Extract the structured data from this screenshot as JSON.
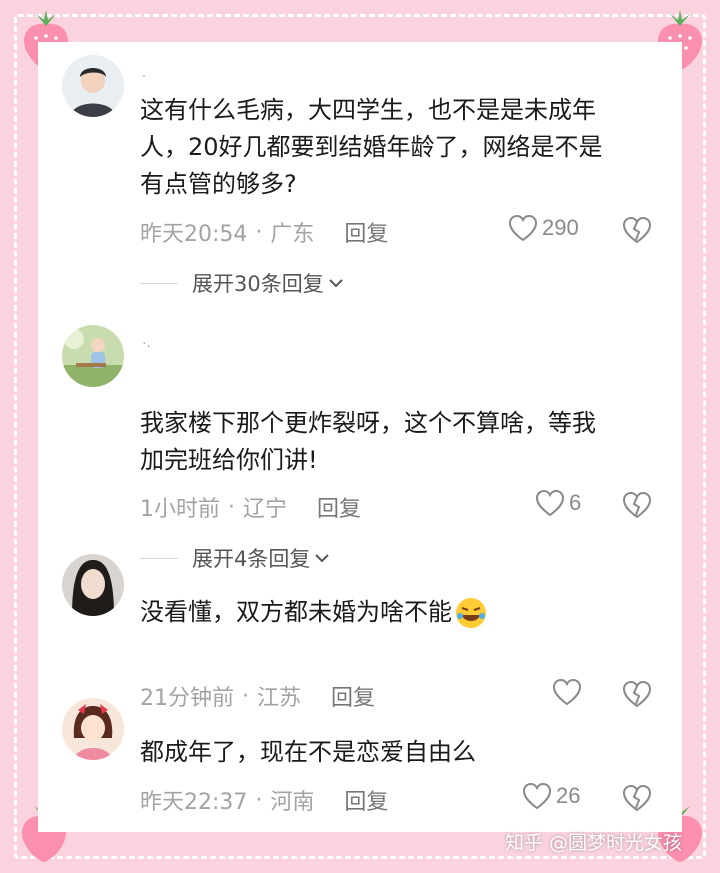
{
  "colors": {
    "frame_pink": "#fbd3df",
    "strawberry": "#fb8fae",
    "leaf": "#5cae5a",
    "text_primary": "#1a1a1a",
    "text_secondary": "#a3a3a3"
  },
  "comments": [
    {
      "username": ".",
      "avatar_icon": "avatar-young-man",
      "text_lines": [
        "这有什么毛病，大四学生，也不是是未成年",
        "人，20好几都要到结婚年龄了，网络是不是",
        "有点管的够多?"
      ],
      "time": "昨天20:54",
      "separator": "·",
      "location": "广东",
      "reply_label": "回复",
      "likes": "290",
      "expand_label": "展开30条回复"
    },
    {
      "username": "·.",
      "avatar_icon": "avatar-child-outdoor",
      "text_lines": [
        "我家楼下那个更炸裂呀，这个不算啥，等我",
        "加完班给你们讲!"
      ],
      "time": "1小时前",
      "separator": "·",
      "location": "辽宁",
      "reply_label": "回复",
      "likes": "6",
      "expand_label": "展开4条回复"
    },
    {
      "username": "",
      "avatar_icon": "avatar-woman",
      "text_lines": [
        "没看懂，双方都未婚为啥不能"
      ],
      "emoji": "rolling-laughing-emoji",
      "time": "21分钟前",
      "separator": "·",
      "location": "江苏",
      "reply_label": "回复",
      "likes": ""
    },
    {
      "username": "",
      "avatar_icon": "avatar-cartoon-girl",
      "text_lines": [
        "都成年了，现在不是恋爱自由么"
      ],
      "time": "昨天22:37",
      "separator": "·",
      "location": "河南",
      "reply_label": "回复",
      "likes": "26"
    }
  ],
  "watermark": "知乎 @圆梦时光女孩"
}
